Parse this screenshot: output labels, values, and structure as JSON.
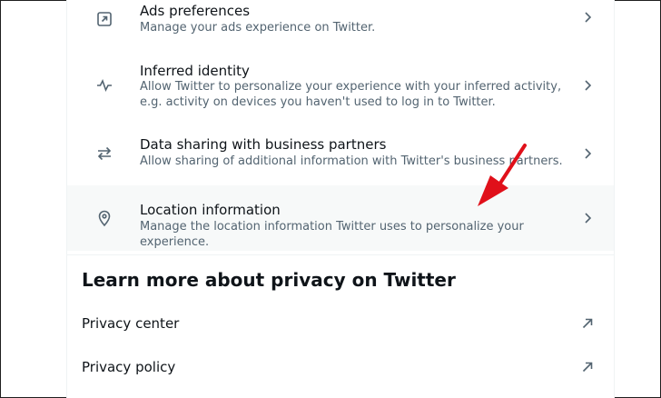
{
  "rows": [
    {
      "title": "Ads preferences",
      "desc": "Manage your ads experience on Twitter."
    },
    {
      "title": "Inferred identity",
      "desc": "Allow Twitter to personalize your experience with your inferred activity, e.g. activity on devices you haven't used to log in to Twitter."
    },
    {
      "title": "Data sharing with business partners",
      "desc": "Allow sharing of additional information with Twitter's business partners."
    },
    {
      "title": "Location information",
      "desc": "Manage the location information Twitter uses to personalize your experience."
    }
  ],
  "section": {
    "title": "Learn more about privacy on Twitter"
  },
  "links": [
    {
      "label": "Privacy center"
    },
    {
      "label": "Privacy policy"
    }
  ],
  "icons": {
    "ads": "external-box-icon",
    "inferred": "activity-icon",
    "sharing": "swap-arrows-icon",
    "location": "location-pin-icon",
    "chevron": "chevron-right-icon",
    "external": "external-link-icon"
  },
  "colors": {
    "text_primary": "#0f1419",
    "text_secondary": "#536471",
    "hover_bg": "#f7f9f9",
    "annotation_arrow": "#e0101a"
  }
}
